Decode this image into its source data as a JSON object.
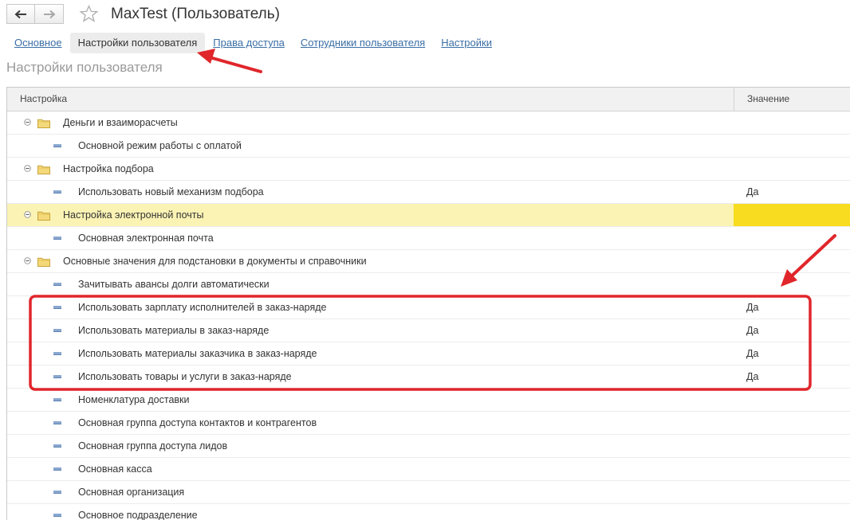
{
  "window": {
    "title": "MaxTest (Пользователь)"
  },
  "tabs": [
    {
      "label": "Основное"
    },
    {
      "label": "Настройки пользователя"
    },
    {
      "label": "Права доступа"
    },
    {
      "label": "Сотрудники пользователя"
    },
    {
      "label": "Настройки"
    }
  ],
  "page_title": "Настройки пользователя",
  "table": {
    "columns": [
      "Настройка",
      "Значение"
    ],
    "rows": [
      {
        "label": "Деньги и взаиморасчеты",
        "value": ""
      },
      {
        "label": "Основной режим работы с оплатой",
        "value": ""
      },
      {
        "label": "Настройка подбора",
        "value": ""
      },
      {
        "label": "Использовать новый механизм подбора",
        "value": "Да"
      },
      {
        "label": "Настройка электронной почты",
        "value": ""
      },
      {
        "label": "Основная электронная почта",
        "value": ""
      },
      {
        "label": "Основные значения для подстановки в документы и справочники",
        "value": ""
      },
      {
        "label": "Зачитывать авансы долги автоматически",
        "value": ""
      },
      {
        "label": "Использовать зарплату исполнителей в заказ-наряде",
        "value": "Да"
      },
      {
        "label": "Использовать материалы в заказ-наряде",
        "value": "Да"
      },
      {
        "label": "Использовать материалы заказчика в заказ-наряде",
        "value": "Да"
      },
      {
        "label": "Использовать товары и услуги в заказ-наряде",
        "value": "Да"
      },
      {
        "label": "Номенклатура доставки",
        "value": ""
      },
      {
        "label": "Основная группа доступа контактов и контрагентов",
        "value": ""
      },
      {
        "label": "Основная группа доступа лидов",
        "value": ""
      },
      {
        "label": "Основная касса",
        "value": ""
      },
      {
        "label": "Основная организация",
        "value": ""
      },
      {
        "label": "Основное подразделение",
        "value": ""
      }
    ]
  },
  "colors": {
    "annotation": "#e0262b",
    "selected_row": "#fbf3b4",
    "selected_cell": "#f8dc20",
    "link": "#3a6ea5"
  }
}
